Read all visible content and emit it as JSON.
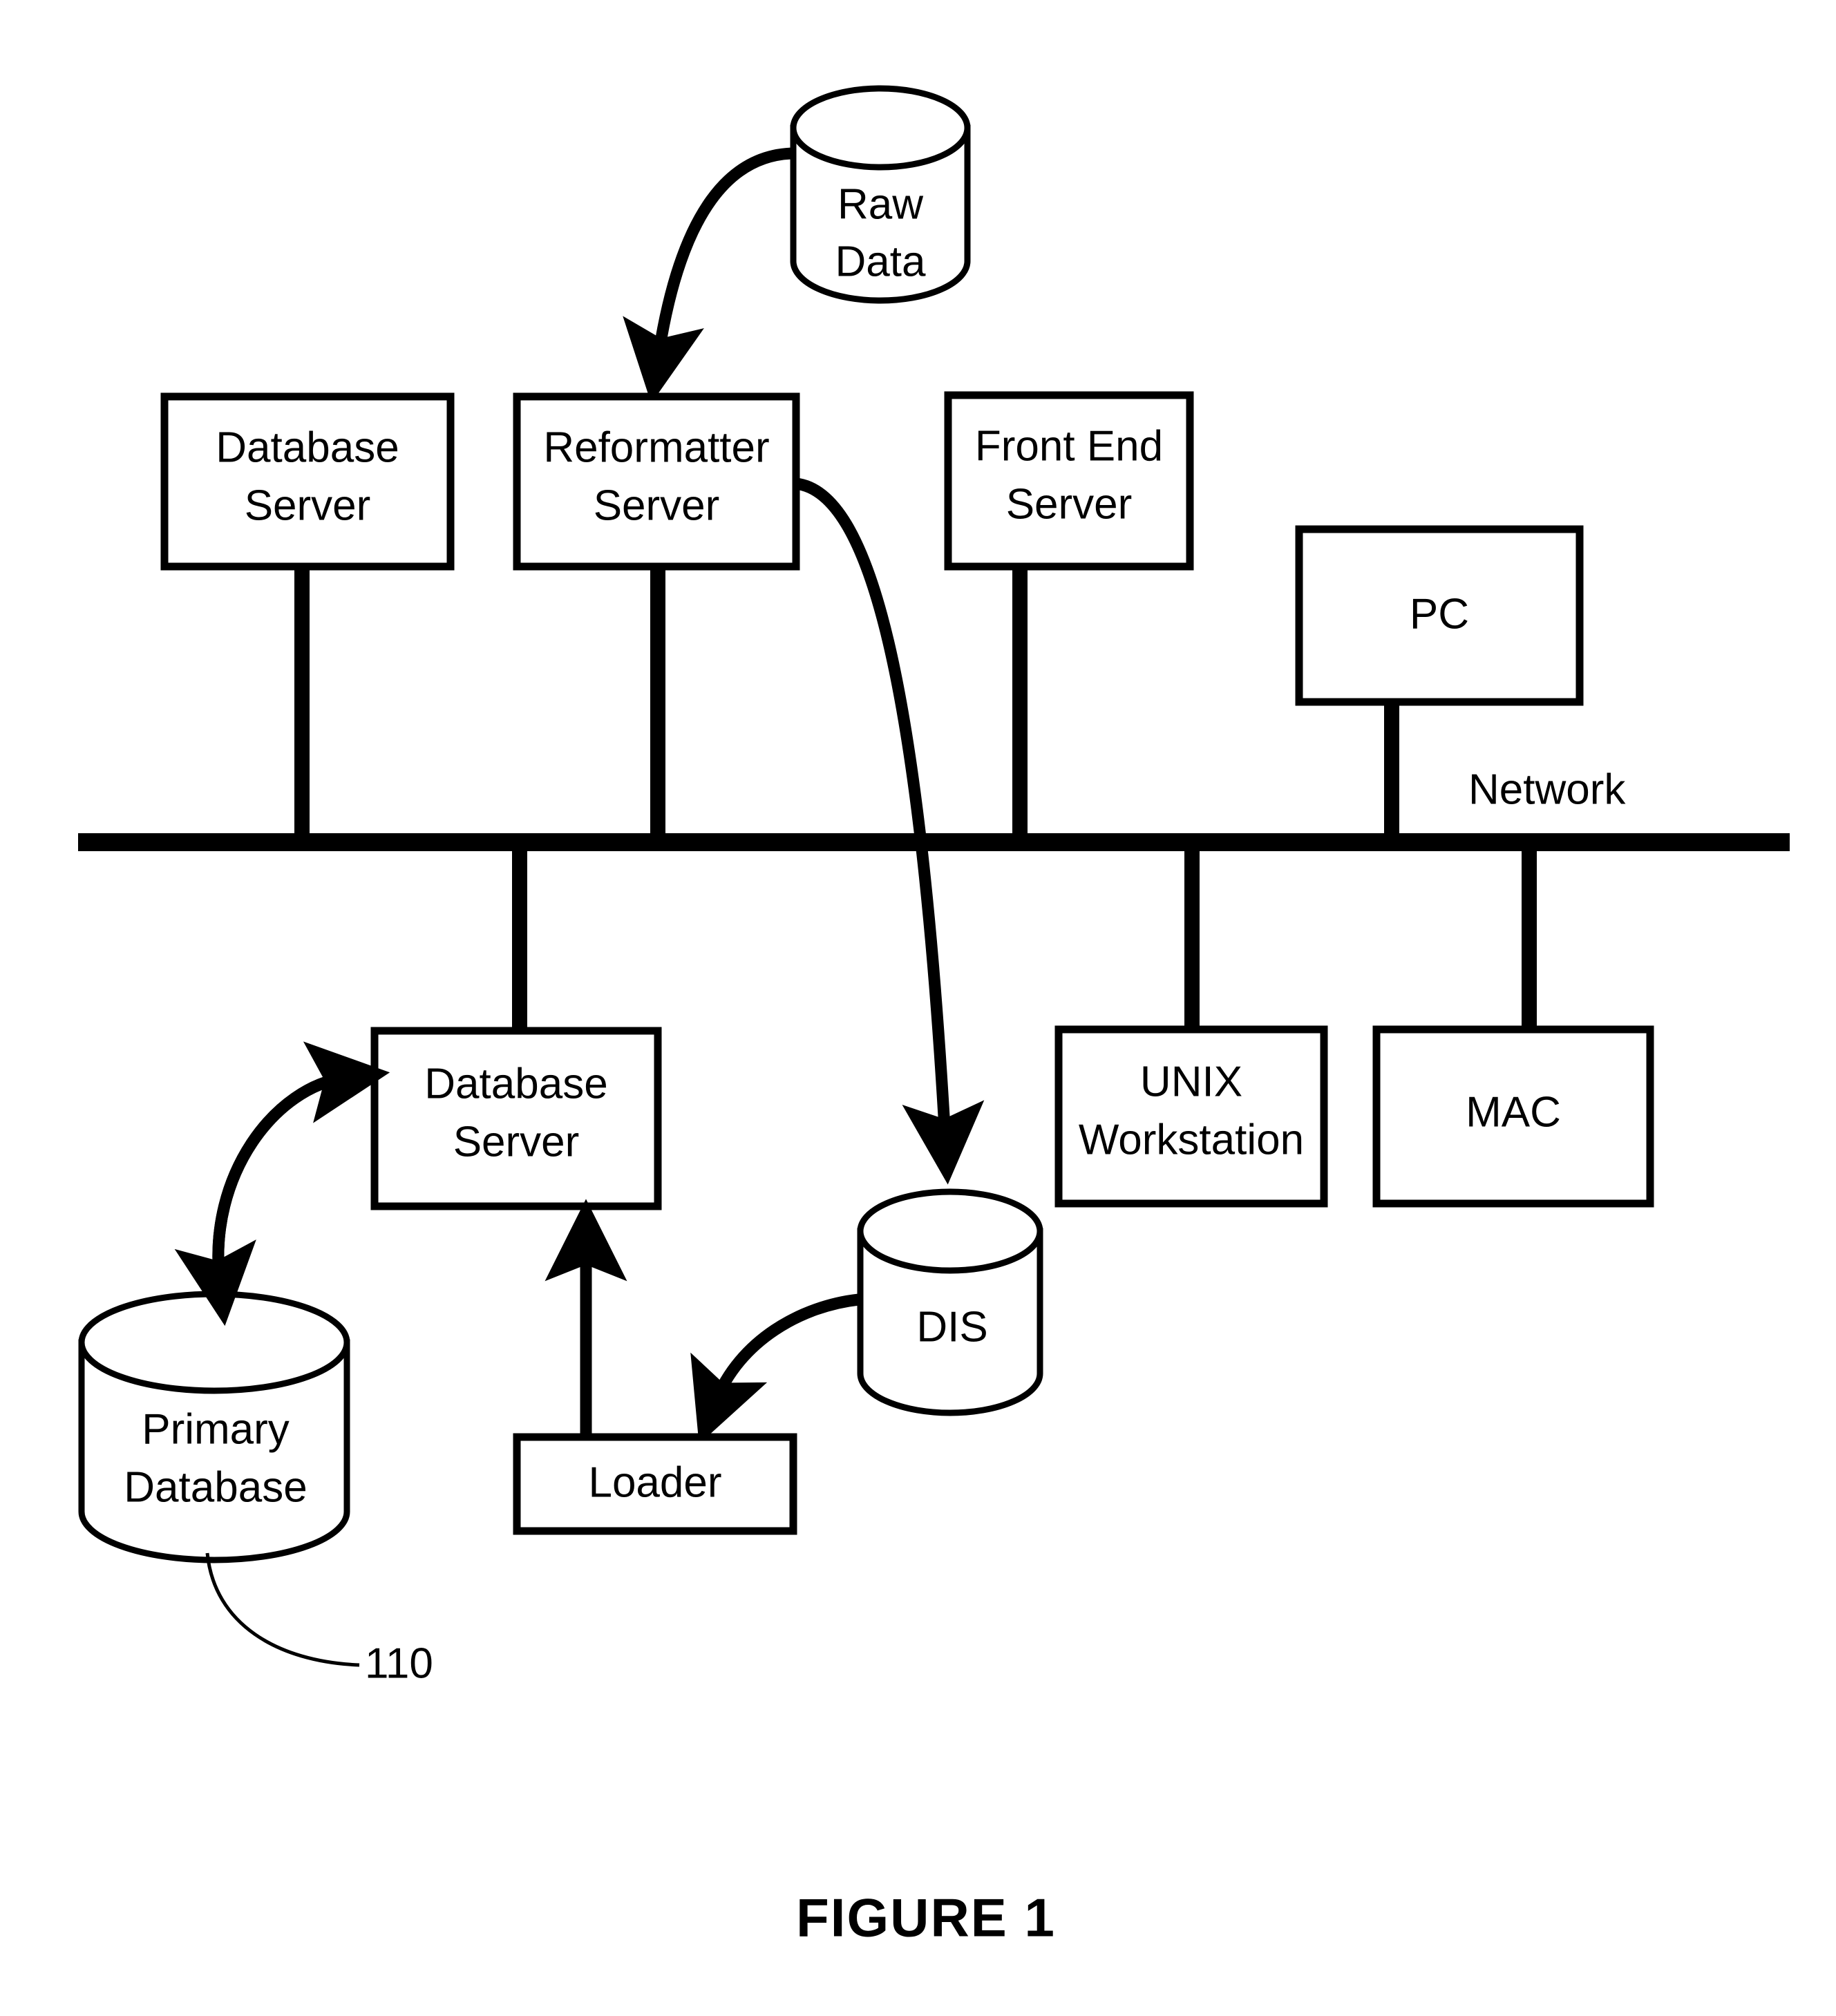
{
  "figure": {
    "caption": "FIGURE  1",
    "reference_numeral": "110",
    "bus_label": "Network"
  },
  "nodes": {
    "raw_data": {
      "label_line1": "Raw",
      "label_line2": "Data",
      "shape": "cylinder"
    },
    "database_server_top": {
      "label_line1": "Database",
      "label_line2": "Server",
      "shape": "box"
    },
    "reformatter_server": {
      "label_line1": "Reformatter",
      "label_line2": "Server",
      "shape": "box"
    },
    "front_end_server": {
      "label_line1": "Front End",
      "label_line2": "Server",
      "shape": "box"
    },
    "pc": {
      "label_line1": "PC",
      "label_line2": "",
      "shape": "box"
    },
    "database_server_bottom": {
      "label_line1": "Database",
      "label_line2": "Server",
      "shape": "box"
    },
    "unix_workstation": {
      "label_line1": "UNIX",
      "label_line2": "Workstation",
      "shape": "box"
    },
    "mac": {
      "label_line1": "MAC",
      "label_line2": "",
      "shape": "box"
    },
    "dis": {
      "label_line1": "DIS",
      "label_line2": "",
      "shape": "cylinder"
    },
    "loader": {
      "label_line1": "Loader",
      "label_line2": "",
      "shape": "box"
    },
    "primary_database": {
      "label_line1": "Primary",
      "label_line2": "Database",
      "shape": "cylinder"
    }
  },
  "colors": {
    "stroke": "#000000",
    "fill": "#ffffff"
  },
  "chart_data": {
    "type": "diagram",
    "title": "FIGURE  1",
    "nodes": [
      "Raw Data",
      "Database Server",
      "Reformatter Server",
      "Front End Server",
      "PC",
      "Database Server",
      "UNIX Workstation",
      "MAC",
      "DIS",
      "Loader",
      "Primary Database"
    ],
    "bus": "Network",
    "edges": [
      {
        "from": "Raw Data",
        "to": "Reformatter Server",
        "style": "curved-arrow"
      },
      {
        "from": "Reformatter Server",
        "to": "DIS",
        "style": "curved-arrow"
      },
      {
        "from": "DIS",
        "to": "Loader",
        "style": "curved-arrow"
      },
      {
        "from": "Loader",
        "to": "Database Server",
        "style": "straight-arrow"
      },
      {
        "from": "Database Server",
        "to": "Primary Database",
        "style": "curved-double-arrow"
      },
      {
        "from": "Database Server",
        "to": "Network",
        "style": "bus-stem"
      },
      {
        "from": "Reformatter Server",
        "to": "Network",
        "style": "bus-stem"
      },
      {
        "from": "Front End Server",
        "to": "Network",
        "style": "bus-stem"
      },
      {
        "from": "PC",
        "to": "Network",
        "style": "bus-stem"
      },
      {
        "from": "Network",
        "to": "Database Server",
        "style": "bus-stem"
      },
      {
        "from": "Network",
        "to": "UNIX Workstation",
        "style": "bus-stem"
      },
      {
        "from": "Network",
        "to": "MAC",
        "style": "bus-stem"
      }
    ],
    "annotations": [
      {
        "text": "110",
        "points_to": "Primary Database"
      }
    ]
  }
}
